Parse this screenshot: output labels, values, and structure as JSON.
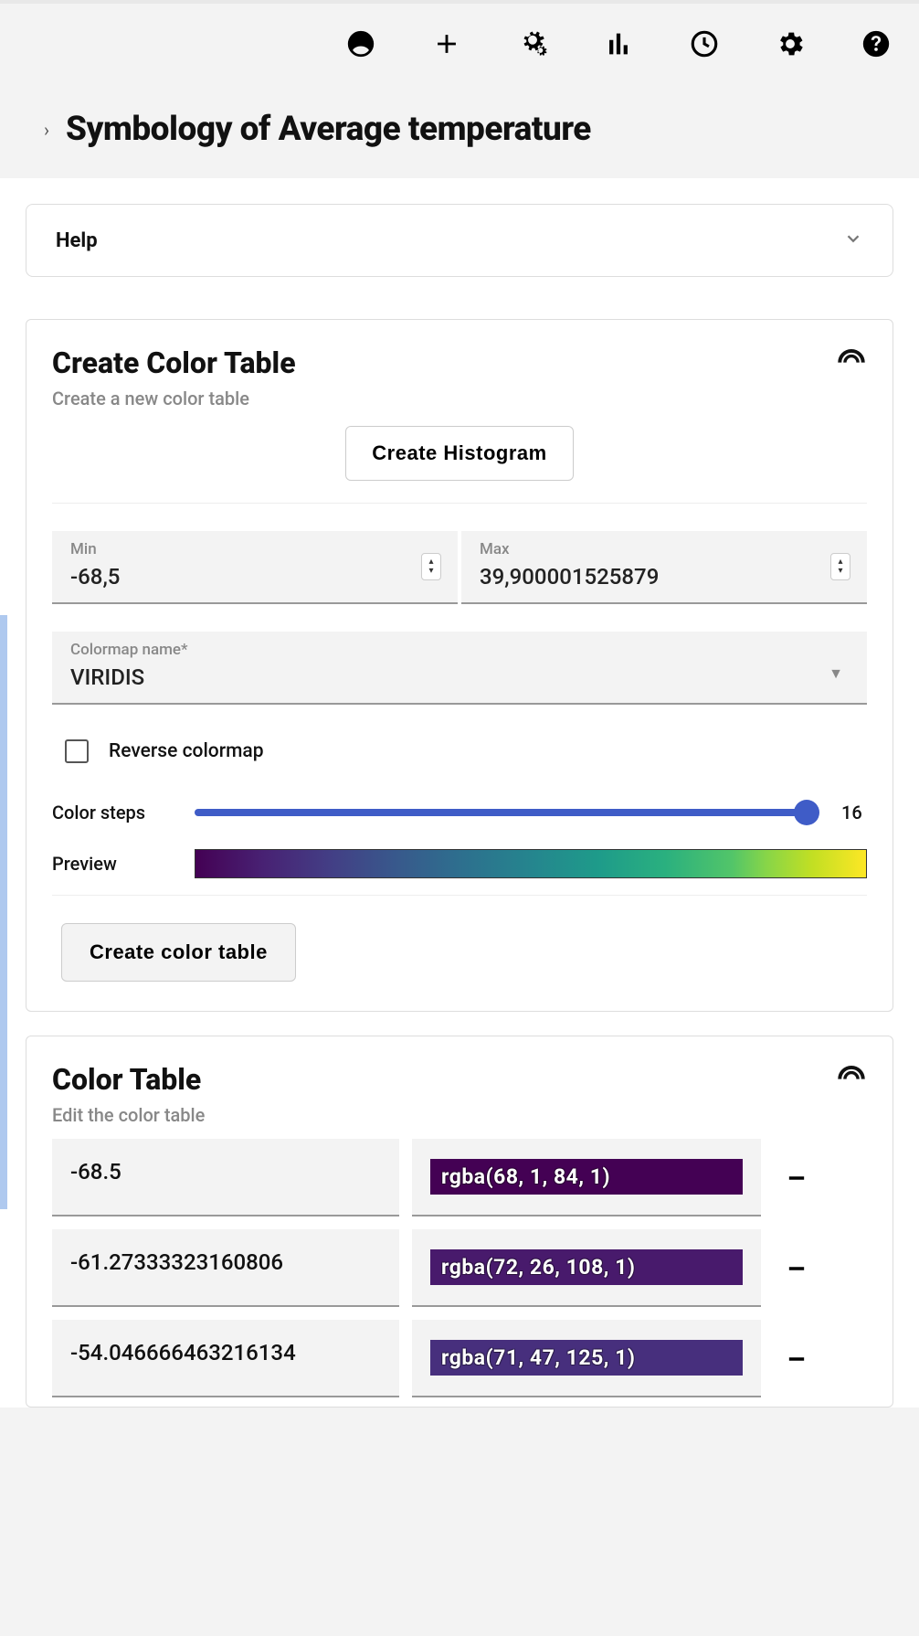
{
  "header": {
    "title": "Symbology of Average temperature"
  },
  "help": {
    "label": "Help"
  },
  "createColorTable": {
    "title": "Create Color Table",
    "subtitle": "Create a new color table",
    "createHistogramLabel": "Create Histogram",
    "minLabel": "Min",
    "minValue": "-68,5",
    "maxLabel": "Max",
    "maxValue": "39,900001525879",
    "colormapLabel": "Colormap name*",
    "colormapValue": "VIRIDIS",
    "reverseLabel": "Reverse colormap",
    "colorStepsLabel": "Color steps",
    "colorStepsValue": "16",
    "previewLabel": "Preview",
    "createColorTableLabel": "Create color table"
  },
  "colorTable": {
    "title": "Color Table",
    "subtitle": "Edit the color table",
    "rows": [
      {
        "value": "-68.5",
        "color": "rgba(68, 1, 84, 1)",
        "bg": "#440154"
      },
      {
        "value": "-61.27333323160806",
        "color": "rgba(72, 26, 108, 1)",
        "bg": "#481a6c"
      },
      {
        "value": "-54.046666463216134",
        "color": "rgba(71, 47, 125, 1)",
        "bg": "#472f7d"
      }
    ]
  }
}
